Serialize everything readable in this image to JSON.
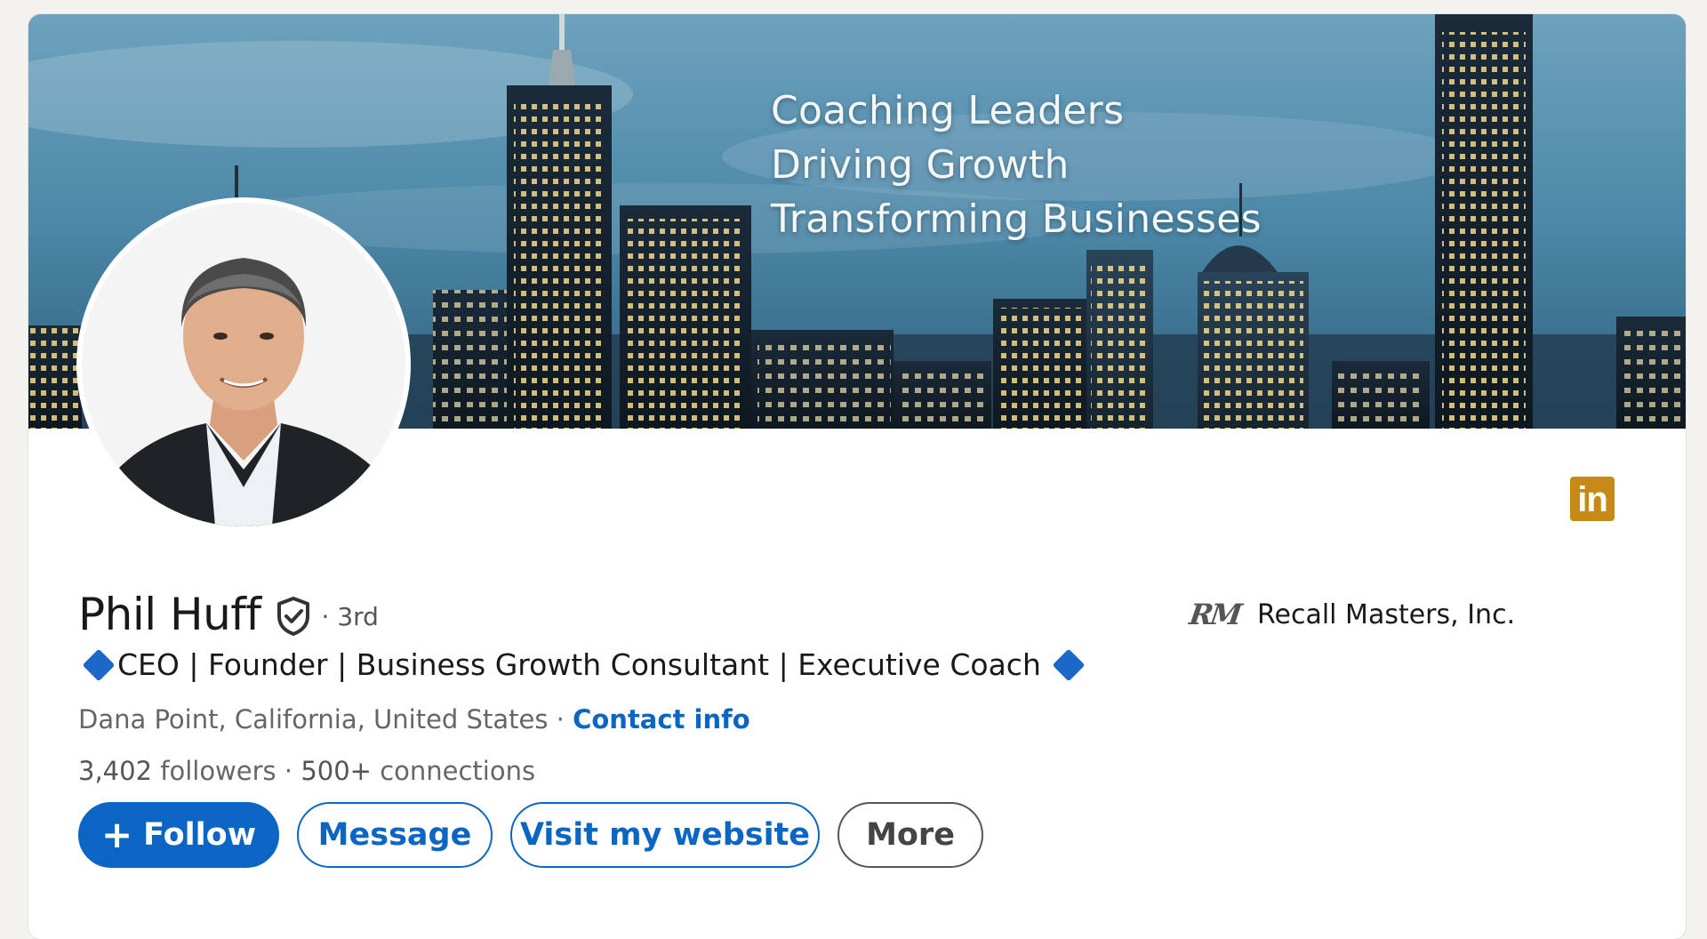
{
  "banner": {
    "lines": [
      "Coaching Leaders",
      "Driving Growth",
      "Transforming Businesses"
    ]
  },
  "profile": {
    "name": "Phil Huff",
    "verified_icon": "shield-check-icon",
    "degree": "· 3rd",
    "headline": "CEO | Founder | Business Growth Consultant | Executive Coach",
    "headline_icon": "blue-diamond-icon",
    "location": "Dana Point, California, United States",
    "separator": " · ",
    "contact_info": "Contact info",
    "followers_count": "3,402",
    "followers_label": "followers",
    "connections_prefix": " · ",
    "connections_count": "500+",
    "connections_label": "connections"
  },
  "actions": {
    "follow_icon": "+",
    "follow": "Follow",
    "message": "Message",
    "website": "Visit my website",
    "more": "More"
  },
  "company": {
    "logo_text": "RM",
    "name": "Recall Masters, Inc."
  },
  "linkedin_badge": {
    "text": "in"
  },
  "colors": {
    "primary": "#0a66c2",
    "badge": "#c88a17",
    "diamond": "#1c68c9"
  }
}
